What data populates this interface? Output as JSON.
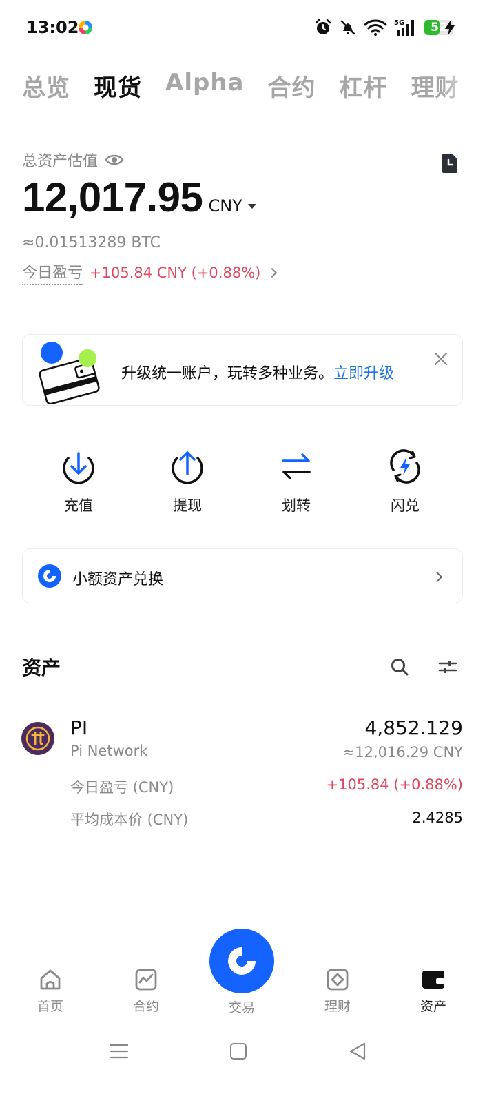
{
  "status_bar": {
    "time": "13:02",
    "network": "5G",
    "battery": "52",
    "battery_level": 0.52
  },
  "tabs": [
    {
      "label": "总览",
      "active": false
    },
    {
      "label": "现货",
      "active": true
    },
    {
      "label": "Alpha",
      "active": false
    },
    {
      "label": "合约",
      "active": false
    },
    {
      "label": "杠杆",
      "active": false
    },
    {
      "label": "理财",
      "active": false
    }
  ],
  "balance": {
    "label": "总资产估值",
    "amount": "12,017.95",
    "currency": "CNY",
    "btc_equiv": "≈0.01513289 BTC",
    "pnl_label": "今日盈亏",
    "pnl_value": "+105.84 CNY (+0.88%)"
  },
  "banner": {
    "text": "升级统一账户，玩转多种业务。",
    "link": "立即升级"
  },
  "actions": [
    {
      "label": "充值",
      "icon": "deposit-icon"
    },
    {
      "label": "提现",
      "icon": "withdraw-icon"
    },
    {
      "label": "划转",
      "icon": "transfer-icon"
    },
    {
      "label": "闪兑",
      "icon": "flash-convert-icon"
    }
  ],
  "dust": {
    "label": "小额资产兑换"
  },
  "assets": {
    "title": "资产",
    "items": [
      {
        "symbol": "PI",
        "name": "Pi Network",
        "amount": "4,852.129",
        "value": "≈12,016.29 CNY",
        "pnl_label": "今日盈亏 (CNY)",
        "pnl": "+105.84 (+0.88%)",
        "cost_label": "平均成本价 (CNY)",
        "cost": "2.4285"
      }
    ]
  },
  "bottom_nav": [
    {
      "label": "首页",
      "icon": "home-icon",
      "active": false
    },
    {
      "label": "合约",
      "icon": "futures-icon",
      "active": false
    },
    {
      "label": "交易",
      "icon": "trade-icon",
      "active": false
    },
    {
      "label": "理财",
      "icon": "earn-icon",
      "active": false
    },
    {
      "label": "资产",
      "icon": "wallet-icon",
      "active": true
    }
  ],
  "colors": {
    "accent": "#1463ff",
    "link": "#1a73e8",
    "positive": "#e0475c",
    "muted": "#8a8a8a"
  }
}
